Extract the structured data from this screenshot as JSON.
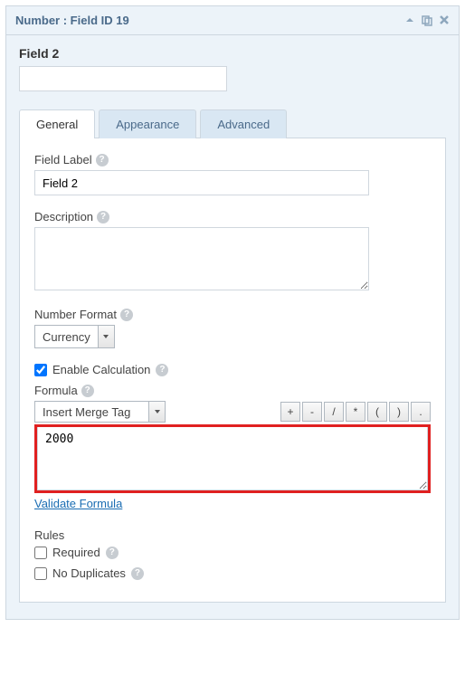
{
  "panel": {
    "title": "Number : Field ID 19"
  },
  "fieldName": "Field 2",
  "tabs": {
    "general": "General",
    "appearance": "Appearance",
    "advanced": "Advanced"
  },
  "labels": {
    "fieldLabel": "Field Label",
    "description": "Description",
    "numberFormat": "Number Format",
    "enableCalc": "Enable Calculation",
    "formula": "Formula",
    "insertMergeTag": "Insert Merge Tag",
    "validateFormula": "Validate Formula",
    "rules": "Rules",
    "required": "Required",
    "noDuplicates": "No Duplicates"
  },
  "values": {
    "fieldLabel": "Field 2",
    "description": "",
    "numberFormat": "Currency",
    "enableCalc": true,
    "formula": "2000",
    "required": false,
    "noDuplicates": false
  },
  "operators": [
    "+",
    "-",
    "/",
    "*",
    "(",
    ")",
    "."
  ]
}
